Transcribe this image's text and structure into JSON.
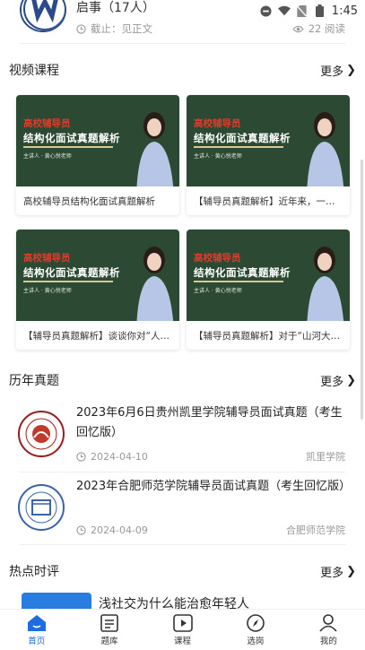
{
  "status_bar": {
    "time": "1:45"
  },
  "top_notice": {
    "title": "启事（17人）",
    "deadline_label": "截止：见正文",
    "reads": "22 阅读"
  },
  "video_section": {
    "title": "视频课程",
    "more": "更多",
    "thumb_red": "高校辅导员",
    "thumb_main": "结构化面试真题解析",
    "thumb_small": "主讲人 · 黄心悦老师",
    "videos": [
      {
        "caption": "高校辅导员结构化面试真题解析"
      },
      {
        "caption": "【辅导员真题解析】近年来，一…"
      },
      {
        "caption": "【辅导员真题解析】谈谈你对“人…"
      },
      {
        "caption": "【辅导员真题解析】对于“山河大…"
      }
    ]
  },
  "exam_section": {
    "title": "历年真题",
    "more": "更多",
    "items": [
      {
        "title": "2023年6月6日贵州凯里学院辅导员面试真题（考生回忆版）",
        "date": "2024-04-10",
        "school": "凯里学院"
      },
      {
        "title": "2023年合肥师范学院辅导员面试真题（考生回忆版）",
        "date": "2024-04-09",
        "school": "合肥师范学院"
      }
    ]
  },
  "news_section": {
    "title": "热点时评",
    "more": "更多",
    "first_title": "浅社交为什么能治愈年轻人"
  },
  "bottom_nav": {
    "items": [
      {
        "label": "首页"
      },
      {
        "label": "题库"
      },
      {
        "label": "课程"
      },
      {
        "label": "选岗"
      },
      {
        "label": "我的"
      }
    ]
  },
  "colors": {
    "accent": "#1d6de0",
    "thumb_bg": "#2c4a33",
    "thumb_red": "#e23a2a"
  }
}
